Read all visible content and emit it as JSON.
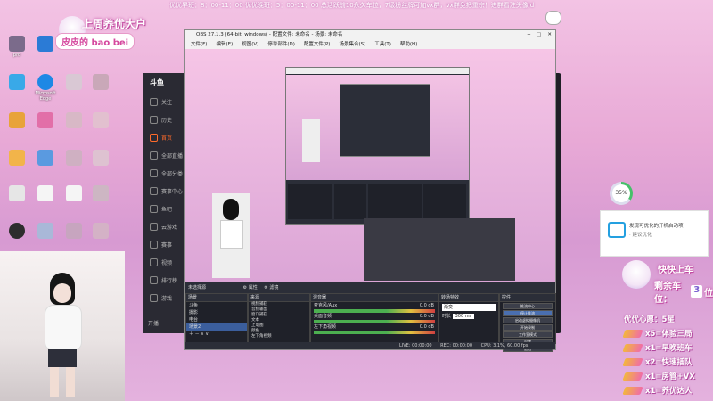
{
  "marquee": "优优早班：8：00-11：00 优优晚班：5：00-11：00 总活跃前10永久车位，7级粉丝牌可加vx群，vx群免把重宗！进群看注头像id",
  "desktop_icons": [
    "pro",
    "Microsoft Edge",
    "",
    "",
    "",
    "",
    "",
    "",
    "",
    "",
    "",
    "",
    "",
    "",
    "",
    "",
    "",
    "",
    "",
    "",
    "",
    "",
    "",
    "",
    "",
    "",
    ""
  ],
  "overlay": {
    "title": "上周养优大户",
    "name_badge": "皮皮的 bao bei"
  },
  "browser": {
    "logo": "斗鱼",
    "sidebar": [
      "关注",
      "历史",
      "首页",
      "全部直播",
      "全部分类",
      "赛事中心",
      "鱼吧",
      "云游戏",
      "赛事",
      "视频",
      "排行榜",
      "游戏"
    ],
    "footer": "开播"
  },
  "obs": {
    "title": "OBS 27.1.3 (64-bit, windows) - 配置文件: 未命名 - 场景: 未命名",
    "menu": [
      "文件(F)",
      "编辑(E)",
      "视图(V)",
      "停靠部件(D)",
      "配置文件(P)",
      "场景集合(S)",
      "工具(T)",
      "帮助(H)"
    ],
    "source_label": "未选择源",
    "prop_btn": "属性",
    "filter_btn": "滤镜",
    "docks": {
      "scenes": {
        "title": "场景",
        "items": [
          "斗鱼",
          "摄影",
          "电台",
          "场景2"
        ]
      },
      "sources": {
        "title": "来源",
        "items": [
          "视频捕获",
          "音频输出",
          "窗口捕获",
          "文本",
          "上电图",
          "颜色",
          "左下角视频"
        ]
      },
      "mixer": {
        "title": "混音器",
        "rows": [
          {
            "name": "麦克风/Aux",
            "db": "0.0 dB"
          },
          {
            "name": "桌面音频",
            "db": "0.0 dB"
          },
          {
            "name": "左下角视频",
            "db": "0.0 dB"
          }
        ]
      },
      "transitions": {
        "title": "转场特效",
        "type": "渐变",
        "duration_label": "时长",
        "duration": "300 ms"
      },
      "controls": {
        "title": "控件",
        "buttons": [
          "推流中心",
          "停止推流",
          "启动虚拟摄像机",
          "开始录制",
          "工作室模式",
          "设置",
          "退出"
        ]
      }
    },
    "status": {
      "live": "LIVE: 00:00:00",
      "rec": "REC: 00:00:00",
      "cpu": "CPU: 3.1%, 60.00 fps"
    }
  },
  "right": {
    "wait_title": "快快上车",
    "seats_label": "剩余车位：",
    "seats": "3",
    "seats_unit": "位",
    "wishlist_title": "优优心愿：5星",
    "wishes": [
      "x5=体验三局",
      "x1=早晚班车",
      "x2=快速插队",
      "x1=房管+VX",
      "x1=养优达人"
    ],
    "cpu_pct": "35%",
    "popup_title": "发现可优化的开机启动项",
    "popup_sub": "· 建议优化"
  }
}
